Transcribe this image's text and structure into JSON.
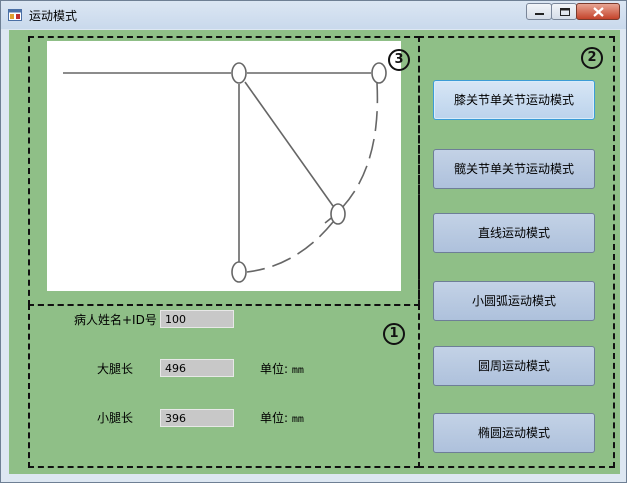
{
  "window": {
    "title": "运动模式"
  },
  "badges": {
    "one": "1",
    "two": "2",
    "three": "3"
  },
  "modes": [
    {
      "label": "膝关节单关节运动模式",
      "active": true
    },
    {
      "label": "髋关节单关节运动模式",
      "active": false
    },
    {
      "label": "直线运动模式",
      "active": false
    },
    {
      "label": "小圆弧运动模式",
      "active": false
    },
    {
      "label": "圆周运动模式",
      "active": false
    },
    {
      "label": "椭圆运动模式",
      "active": false
    }
  ],
  "patient": {
    "name_id_label": "病人姓名+ID号",
    "name_id_value": "100",
    "thigh_label": "大腿长",
    "thigh_value": "496",
    "shank_label": "小腿长",
    "shank_value": "396",
    "unit_label": "单位:",
    "unit_value": "mm"
  },
  "colors": {
    "client_bg": "#8fbf87",
    "button_bg": "#aec1dc",
    "active_border": "#3c9cd6"
  },
  "icons": {
    "app": "app-window-icon",
    "minimize": "minimize-icon",
    "maximize": "maximize-icon",
    "close": "close-icon"
  }
}
